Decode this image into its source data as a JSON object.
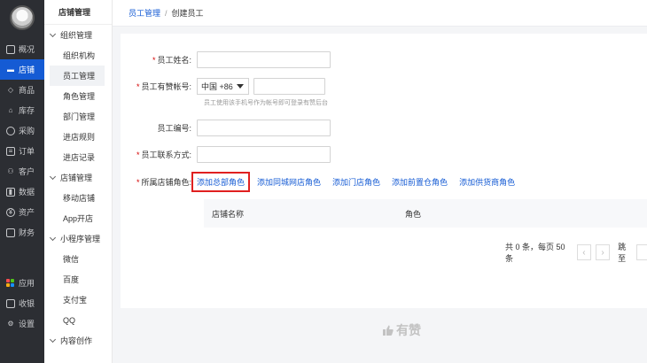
{
  "nav": {
    "items": [
      {
        "label": "概况",
        "icon": "dashboard-icon"
      },
      {
        "label": "店铺",
        "icon": "store-icon",
        "active": true
      },
      {
        "label": "商品",
        "icon": "tag-icon"
      },
      {
        "label": "库存",
        "icon": "house-icon"
      },
      {
        "label": "采购",
        "icon": "purchase-icon"
      },
      {
        "label": "订单",
        "icon": "order-icon"
      },
      {
        "label": "客户",
        "icon": "user-icon"
      },
      {
        "label": "数据",
        "icon": "chart-icon"
      },
      {
        "label": "资产",
        "icon": "asset-icon"
      },
      {
        "label": "财务",
        "icon": "finance-icon"
      }
    ],
    "bottom": [
      {
        "label": "应用",
        "icon": "apps-icon"
      },
      {
        "label": "收银",
        "icon": "cashier-icon"
      },
      {
        "label": "设置",
        "icon": "settings-icon"
      }
    ]
  },
  "subnav": {
    "title": "店铺管理",
    "groups": [
      {
        "label": "组织管理",
        "items": [
          "组织机构",
          "员工管理",
          "角色管理",
          "部门管理",
          "进店规则",
          "进店记录"
        ]
      },
      {
        "label": "店铺管理",
        "items": [
          "移动店铺",
          "App开店"
        ]
      },
      {
        "label": "小程序管理",
        "items": [
          "微信",
          "百度",
          "支付宝",
          "QQ"
        ]
      },
      {
        "label": "内容创作",
        "items": []
      }
    ]
  },
  "breadcrumb": {
    "parent": "员工管理",
    "sep": "/",
    "current": "创建员工"
  },
  "form": {
    "name_label": "员工姓名:",
    "account_label": "员工有赞帐号:",
    "country_code": "中国 +86",
    "account_hint": "员工使用该手机号作为帐号即可登录有赞后台",
    "number_label": "员工编号:",
    "contact_label": "员工联系方式:",
    "role_label": "所属店铺角色:",
    "role_links": [
      "添加总部角色",
      "添加同城网店角色",
      "添加门店角色",
      "添加前置仓角色",
      "添加供货商角色"
    ]
  },
  "table": {
    "headers": [
      "店铺名称",
      "角色"
    ]
  },
  "pager": {
    "summary": "共 0 条，每页 50 条",
    "prev": "‹",
    "next": "›",
    "jump": "跳至"
  },
  "footer": {
    "brand": "有赞"
  },
  "colors": {
    "accent": "#155bd4",
    "nav_bg": "#2c2e33",
    "highlight_border": "#e02020"
  }
}
